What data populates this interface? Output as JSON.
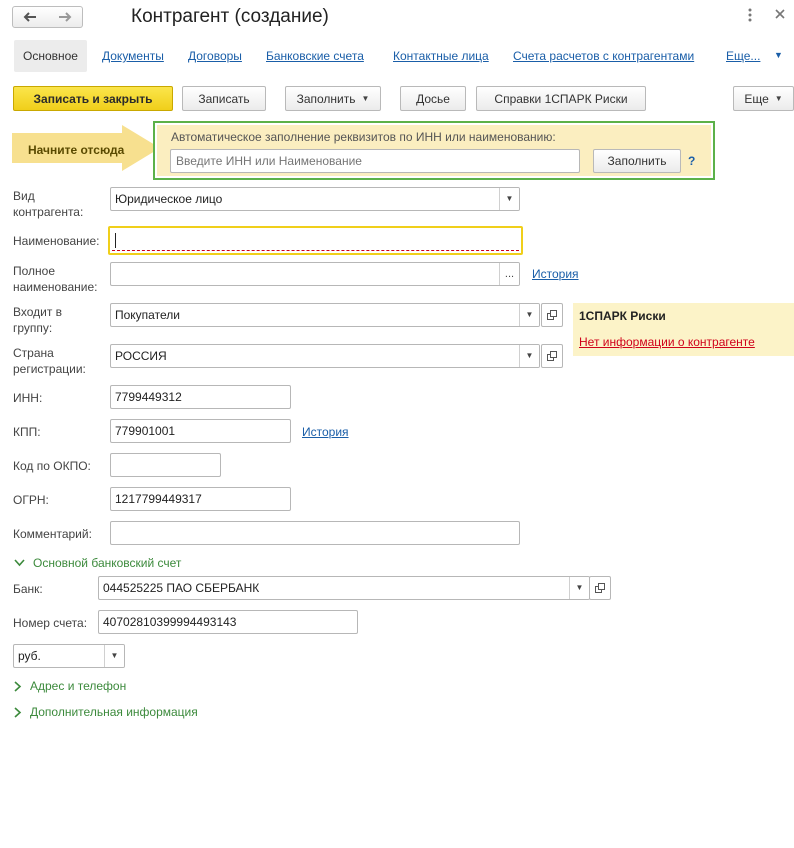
{
  "window": {
    "title": "Контрагент (создание)",
    "back_icon": "arrow-left-icon",
    "forward_icon": "arrow-right-icon",
    "menu_icon": "vertical-dots-icon",
    "close_icon": "close-icon"
  },
  "tabs": [
    {
      "label": "Основное",
      "active": true
    },
    {
      "label": "Документы"
    },
    {
      "label": "Договоры"
    },
    {
      "label": "Банковские счета"
    },
    {
      "label": "Контактные лица"
    },
    {
      "label": "Счета расчетов с контрагентами"
    },
    {
      "label": "Еще..."
    }
  ],
  "toolbar": {
    "save_close": "Записать и закрыть",
    "save": "Записать",
    "fill": "Заполнить",
    "dossier": "Досье",
    "spark": "Справки 1СПАРК Риски",
    "more": "Еще"
  },
  "start_here": "Начните отсюда",
  "autofill": {
    "caption": "Автоматическое заполнение реквизитов по ИНН или наименованию:",
    "placeholder": "Введите ИНН или Наименование",
    "button": "Заполнить",
    "help": "?"
  },
  "form": {
    "kind_label": "Вид контрагента:",
    "kind_value": "Юридическое лицо",
    "name_label": "Наименование:",
    "name_value": "",
    "fullname_label": "Полное наименование:",
    "fullname_value": "",
    "fullname_btn": "...",
    "history": "История",
    "group_label": "Входит в группу:",
    "group_value": "Покупатели",
    "country_label": "Страна регистрации:",
    "country_value": "РОССИЯ",
    "inn_label": "ИНН:",
    "inn_value": "7799449312",
    "kpp_label": "КПП:",
    "kpp_value": "779901001",
    "kpp_history": "История",
    "okpo_label": "Код по ОКПО:",
    "okpo_value": "",
    "ogrn_label": "ОГРН:",
    "ogrn_value": "1217799449317",
    "comment_label": "Комментарий:",
    "comment_value": ""
  },
  "spark_panel": {
    "title": "1СПАРК Риски",
    "link": "Нет информации о контрагенте"
  },
  "bank": {
    "section": "Основной банковский счет",
    "bank_label": "Банк:",
    "bank_value": "044525225 ПАО СБЕРБАНК",
    "account_label": "Номер счета:",
    "account_value": "40702810399994493143",
    "currency_value": "руб."
  },
  "sections": {
    "address": "Адрес и телефон",
    "extra": "Дополнительная информация"
  },
  "colors": {
    "accent_yellow": "#f0cf1a",
    "link_blue": "#1a5ea8",
    "section_green": "#3c8a3c",
    "highlight_border": "#5cb149",
    "error_red": "#d0021b"
  }
}
